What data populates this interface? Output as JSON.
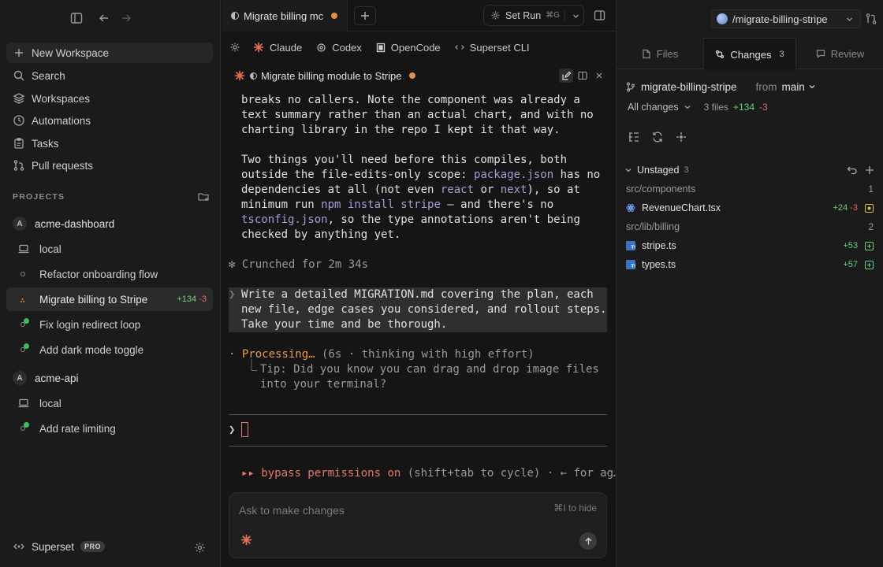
{
  "sidebar": {
    "nav": [
      {
        "label": "New Workspace",
        "icon": "plus-icon"
      },
      {
        "label": "Search",
        "icon": "search-icon"
      },
      {
        "label": "Workspaces",
        "icon": "layers-icon"
      },
      {
        "label": "Automations",
        "icon": "clock-icon"
      },
      {
        "label": "Tasks",
        "icon": "clipboard-icon"
      },
      {
        "label": "Pull requests",
        "icon": "pull-request-icon"
      }
    ],
    "projects_label": "PROJECTS",
    "projects": [
      {
        "badge": "A",
        "name": "acme-dashboard",
        "workspaces": [
          {
            "label": "local",
            "kind": "laptop"
          },
          {
            "label": "Refactor onboarding flow",
            "kind": "idle"
          },
          {
            "label": "Migrate billing to Stripe",
            "kind": "active",
            "additions": "+134",
            "deletions": "-3"
          },
          {
            "label": "Fix login redirect loop",
            "kind": "running"
          },
          {
            "label": "Add dark mode toggle",
            "kind": "running"
          }
        ]
      },
      {
        "badge": "A",
        "name": "acme-api",
        "workspaces": [
          {
            "label": "local",
            "kind": "laptop"
          },
          {
            "label": "Add rate limiting",
            "kind": "running"
          }
        ]
      }
    ],
    "footer": {
      "app_name": "Superset",
      "plan_badge": "PRO"
    }
  },
  "middle": {
    "tab_title": "Migrate billing mc",
    "set_run": {
      "label": "Set Run",
      "shortcut": "⌘G"
    },
    "agents": [
      {
        "label": "Claude",
        "icon": "claude-icon"
      },
      {
        "label": "Codex",
        "icon": "codex-icon"
      },
      {
        "label": "OpenCode",
        "icon": "opencode-icon"
      },
      {
        "label": "Superset CLI",
        "icon": "superset-cli-icon"
      }
    ],
    "session_title": "Migrate billing module to Stripe",
    "terminal": {
      "para1": "breaks no callers. Note the component was already a text summary rather than an actual chart, and with no charting library in the repo I kept it that way.",
      "para2": {
        "t1": "Two things you'll need before this compiles, both outside the file-edits-only scope: ",
        "k1": "package.json",
        "t2": " has no dependencies at all (not even ",
        "k2": "react",
        "t3": " or ",
        "k3": "next",
        "t4": "), so at minimum run ",
        "k4": "npm install stripe",
        "t5": " — and there's no ",
        "k5": "tsconfig.json",
        "t6": ", so the type annotations aren't being checked by anything yet."
      },
      "crunched": "✻ Crunched for 2m 34s",
      "user_msg": "Write a detailed MIGRATION.md covering the plan, each new file, edge cases you considered, and rollout steps. Take your time and be thorough.",
      "processing": "Processing…",
      "processing_meta": " (6s · thinking with high effort)",
      "tip": "Tip: Did you know you can drag and drop image files into your terminal?",
      "prompt_char": "❯",
      "bypass_marker": "▸▸",
      "bypass_on": "bypass permissions on",
      "bypass_rest": " (shift+tab to cycle) · ← for ag…"
    },
    "composer": {
      "placeholder": "Ask to make changes",
      "hide_hint": "⌘I to hide"
    }
  },
  "right": {
    "branch_selector": "/migrate-billing-stripe",
    "tabs": [
      {
        "label": "Files"
      },
      {
        "label": "Changes",
        "count": "3"
      },
      {
        "label": "Review"
      }
    ],
    "branch": "migrate-billing-stripe",
    "from_label": "from",
    "base_branch": "main",
    "filter": {
      "label": "All changes",
      "files": "3 files",
      "additions": "+134",
      "deletions": "-3"
    },
    "unstaged": {
      "label": "Unstaged",
      "count": "3"
    },
    "groups": [
      {
        "folder": "src/components",
        "count": "1",
        "files": [
          {
            "name": "RevenueChart.tsx",
            "additions": "+24",
            "deletions": "-3",
            "status": "modified",
            "icon": "react-icon"
          }
        ]
      },
      {
        "folder": "src/lib/billing",
        "count": "2",
        "files": [
          {
            "name": "stripe.ts",
            "additions": "+53",
            "status": "added",
            "icon": "typescript-icon"
          },
          {
            "name": "types.ts",
            "additions": "+57",
            "status": "added",
            "icon": "typescript-icon"
          }
        ]
      }
    ],
    "colors": {
      "additions": "#6fcf86",
      "deletions": "#e06a6a",
      "modified": "#d9c24a",
      "accent": "#e38f4a"
    }
  }
}
